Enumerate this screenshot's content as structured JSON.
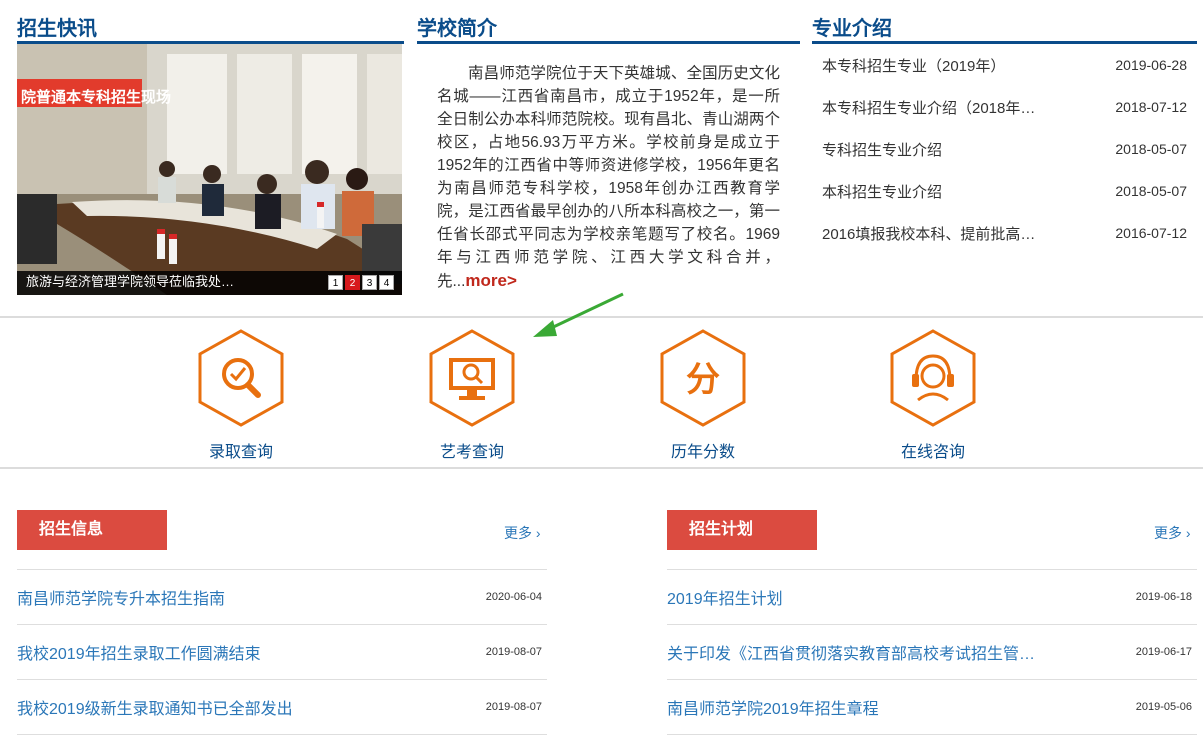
{
  "news": {
    "title": "招生快讯",
    "banner_text": "院普通本专科招生现场",
    "caption": "旅游与经济管理学院领导莅临我处…",
    "dots": [
      "1",
      "2",
      "3",
      "4"
    ],
    "active_dot": 2
  },
  "intro": {
    "title": "学校简介",
    "text": "南昌师范学院位于天下英雄城、全国历史文化名城——江西省南昌市，成立于1952年，是一所全日制公办本科师范院校。现有昌北、青山湖两个校区，占地56.93万平方米。学校前身是成立于1952年的江西省中等师资进修学校，1956年更名为南昌师范专科学校，1958年创办江西教育学院，是江西省最早创办的八所本科高校之一，第一任省长邵式平同志为学校亲笔题写了校名。1969年与江西师范学院、江西大学文科合并，先...",
    "more": "more>"
  },
  "majors": {
    "title": "专业介绍",
    "items": [
      {
        "title": "本专科招生专业（2019年）",
        "date": "2019-06-28"
      },
      {
        "title": "本专科招生专业介绍（2018年…",
        "date": "2018-07-12"
      },
      {
        "title": "专科招生专业介绍",
        "date": "2018-05-07"
      },
      {
        "title": "本科招生专业介绍",
        "date": "2018-05-07"
      },
      {
        "title": "2016填报我校本科、提前批高…",
        "date": "2016-07-12"
      }
    ]
  },
  "quick_links": [
    {
      "label": "录取查询",
      "icon": "search-check-icon"
    },
    {
      "label": "艺考查询",
      "icon": "monitor-search-icon"
    },
    {
      "label": "历年分数",
      "icon": "score-icon",
      "glyph": "分"
    },
    {
      "label": "在线咨询",
      "icon": "headset-icon"
    }
  ],
  "accent_colors": {
    "brand_blue": "#0a4c8a",
    "orange": "#e8700f",
    "red_tab": "#db4b40",
    "link_blue": "#2b77b8",
    "arrow_green": "#3aa935"
  },
  "admissions_info": {
    "title": "招生信息",
    "more": "更多 ›",
    "items": [
      {
        "title": "南昌师范学院专升本招生指南",
        "date": "2020-06-04"
      },
      {
        "title": "我校2019年招生录取工作圆满结束",
        "date": "2019-08-07"
      },
      {
        "title": "我校2019级新生录取通知书已全部发出",
        "date": "2019-08-07"
      }
    ]
  },
  "admissions_plan": {
    "title": "招生计划",
    "more": "更多 ›",
    "items": [
      {
        "title": "2019年招生计划",
        "date": "2019-06-18"
      },
      {
        "title": "关于印发《江西省贯彻落实教育部高校考试招生管…",
        "date": "2019-06-17"
      },
      {
        "title": "南昌师范学院2019年招生章程",
        "date": "2019-05-06"
      }
    ]
  }
}
